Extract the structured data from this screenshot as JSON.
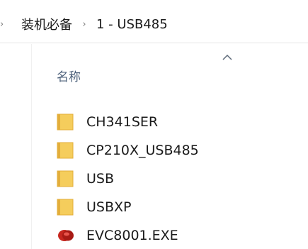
{
  "breadcrumb": {
    "items": [
      "装机必备",
      "1 - USB485"
    ]
  },
  "column": {
    "name_header": "名称",
    "sort_icon": "chevron-up-icon"
  },
  "files": [
    {
      "name": "CH341SER",
      "icon": "folder-icon"
    },
    {
      "name": "CP210X_USB485",
      "icon": "folder-icon"
    },
    {
      "name": "USB",
      "icon": "folder-icon"
    },
    {
      "name": "USBXP",
      "icon": "folder-icon"
    },
    {
      "name": "EVC8001.EXE",
      "icon": "application-icon"
    }
  ],
  "colors": {
    "folder": "#F5CD5C",
    "folder_dark": "#E3AE3A",
    "app": "#C7271F",
    "header_text": "#4C607A"
  }
}
